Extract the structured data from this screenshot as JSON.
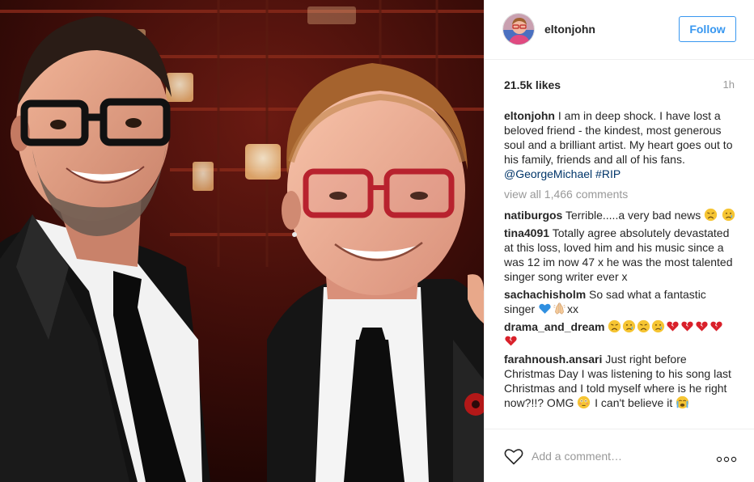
{
  "header": {
    "username": "eltonjohn",
    "follow_label": "Follow"
  },
  "stats": {
    "likes": "21.5k likes",
    "time": "1h"
  },
  "caption": {
    "username": "eltonjohn",
    "text": "I am in deep shock. I have lost a beloved friend - the kindest, most generous soul and a brilliant artist. My heart goes out to his family, friends and all of his fans.",
    "mention": "@GeorgeMichael",
    "hashtag": "#RIP"
  },
  "view_all": "view all 1,466 comments",
  "comments": [
    {
      "user": "natiburgos",
      "text": "Terrible.....a very bad news",
      "tail": ""
    },
    {
      "user": "tina4091",
      "text": "Totally agree absolutely devastated at this loss, loved him and his music since a was 12 im now 47 x he was the most talented singer song writer ever x",
      "tail": ""
    },
    {
      "user": "sachachisholm",
      "text": "So sad what a fantastic singer",
      "tail": "xx"
    },
    {
      "user": "drama_and_dream",
      "text": "",
      "tail": ""
    },
    {
      "user": "farahnoush.ansari",
      "text": "Just right before Christmas Day I was listening to his song last Christmas and I told myself where is he right now?!!? OMG",
      "tail": "I can't believe it"
    }
  ],
  "footer": {
    "comment_placeholder": "Add a comment…"
  },
  "icons": {
    "like": "heart-outline-icon",
    "more": "ellipsis-icon"
  },
  "colors": {
    "accent": "#3897f0",
    "link": "#003569",
    "muted": "#999999"
  }
}
